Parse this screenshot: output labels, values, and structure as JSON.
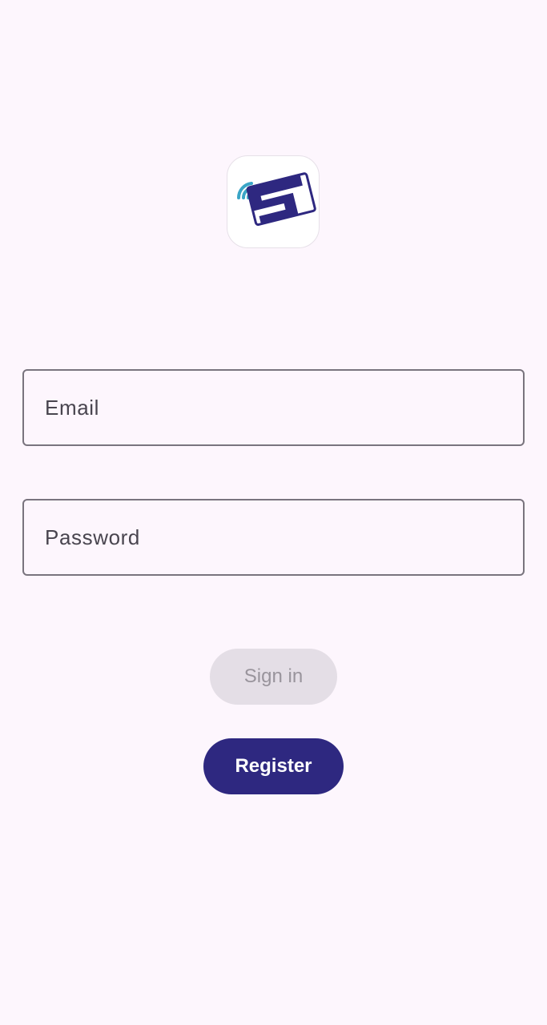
{
  "app": {
    "logo_icon": "card-wireless-logo-icon",
    "brand_color": "#2e2880",
    "accent_color": "#3aa5c6"
  },
  "form": {
    "email": {
      "placeholder": "Email",
      "value": ""
    },
    "password": {
      "placeholder": "Password",
      "value": ""
    }
  },
  "buttons": {
    "sign_in_label": "Sign in",
    "sign_in_enabled": false,
    "register_label": "Register"
  }
}
